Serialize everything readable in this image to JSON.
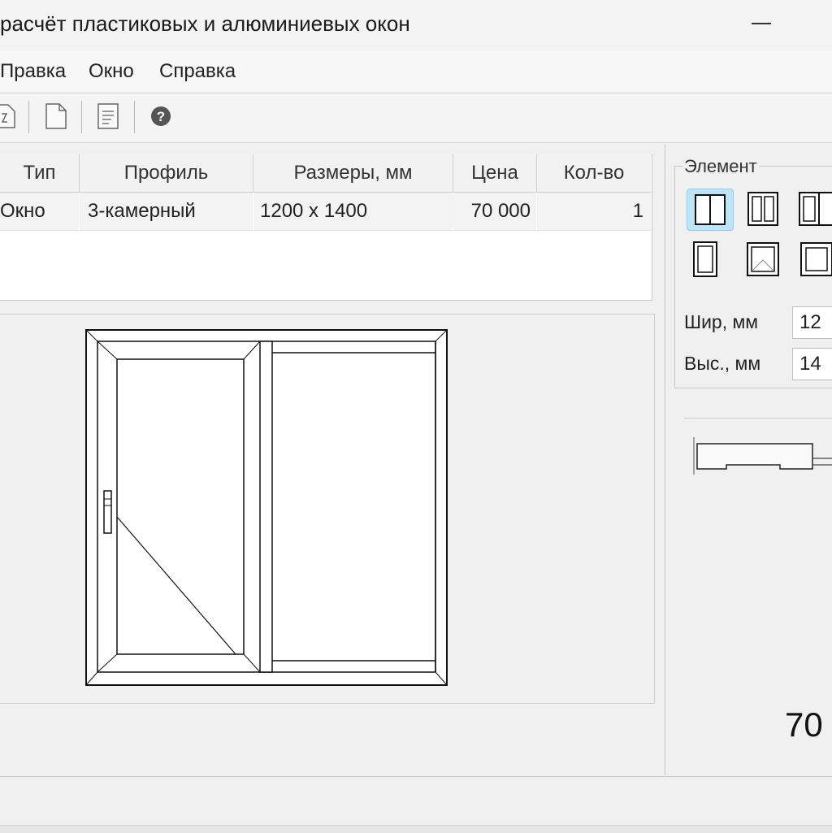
{
  "window": {
    "title": "расчёт пластиковых и алюминиевых окон"
  },
  "menu": {
    "items": [
      "Правка",
      "Окно",
      "Справка"
    ]
  },
  "toolbar": {
    "icons": [
      "refresh-doc-icon",
      "new-document-icon",
      "text-document-icon",
      "help-icon"
    ]
  },
  "table": {
    "headers": [
      "Тип",
      "Профиль",
      "Размеры, мм",
      "Цена",
      "Кол-во"
    ],
    "rows": [
      {
        "type": "Окно",
        "profile": "3-камерный",
        "size": "1200 x 1400",
        "price": "70 000",
        "qty": "1"
      }
    ]
  },
  "element_panel": {
    "title": "Элемент",
    "selected_index": 0,
    "width_label": "Шир, мм",
    "width_value": "12",
    "height_label": "Выс., мм",
    "height_value": "14"
  },
  "summary": {
    "total": "70"
  }
}
